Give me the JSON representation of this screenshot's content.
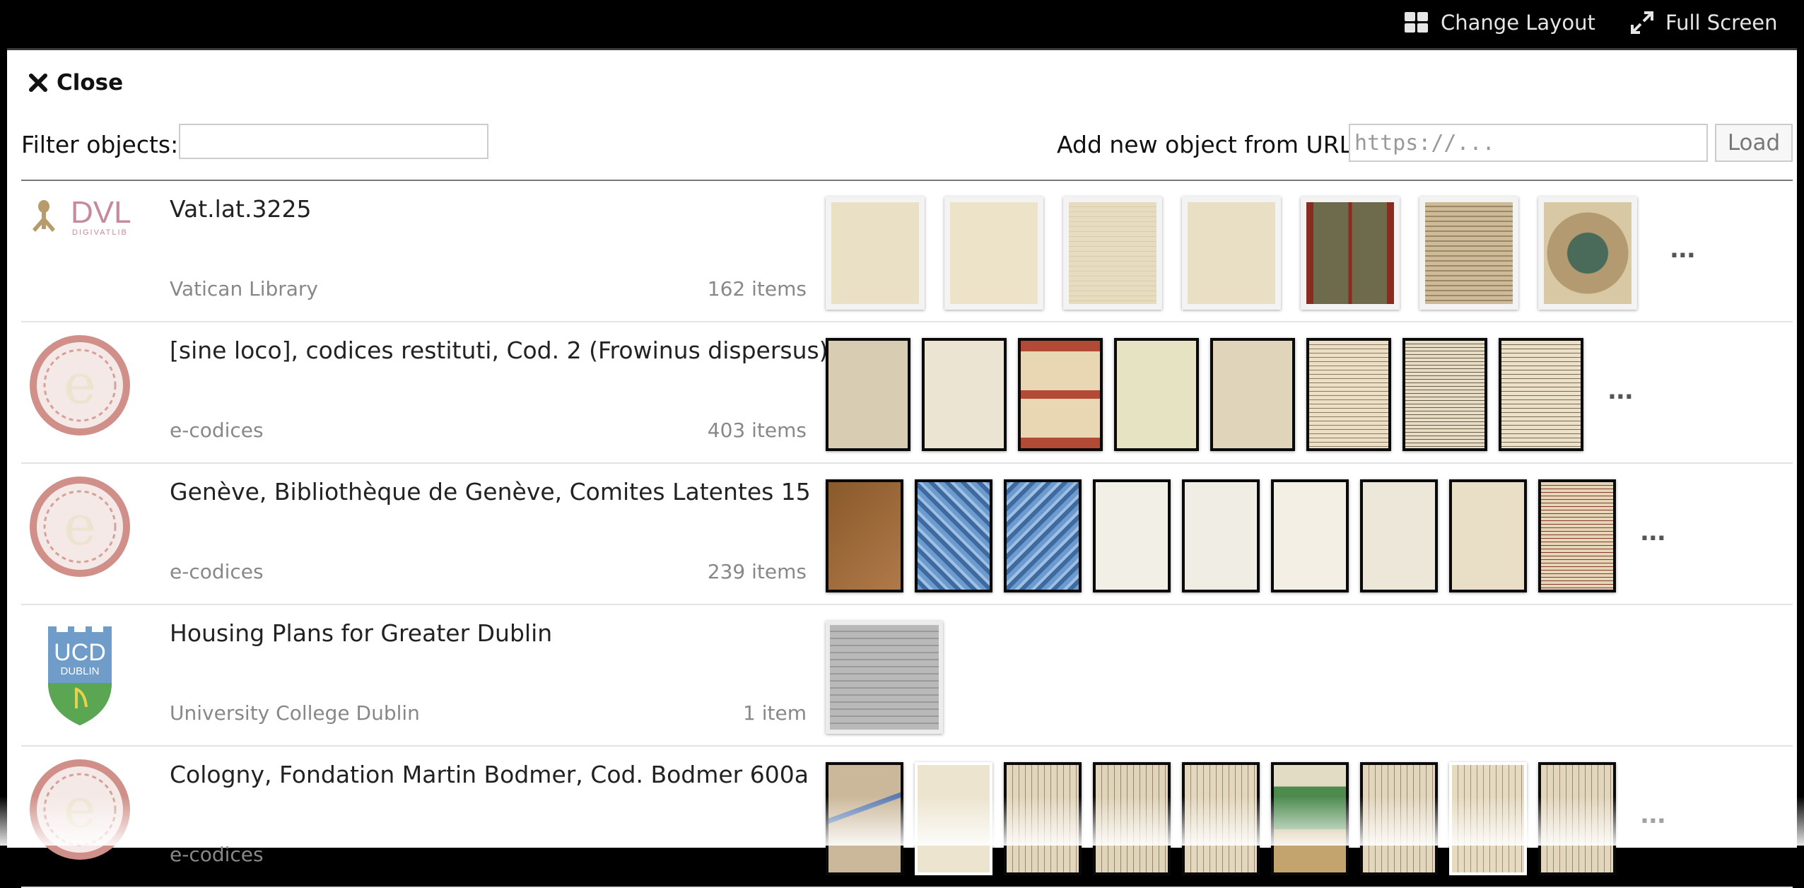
{
  "topbar": {
    "change_layout": "Change Layout",
    "full_screen": "Full Screen"
  },
  "panel": {
    "close_label": "Close",
    "filter_label": "Filter objects:",
    "filter_value": "",
    "url_label": "Add new object from URL:",
    "url_placeholder": "https://...",
    "load_label": "Load"
  },
  "objects": [
    {
      "title": "Vat.lat.3225",
      "provider": "Vatican Library",
      "count": "162 items",
      "logo": "dvl-logo",
      "thumb_style": "light",
      "thumb_count": 7
    },
    {
      "title": "[sine loco], codices restituti, Cod. 2 (Frowinus dispersus)",
      "provider": "e-codices",
      "count": "403 items",
      "logo": "e-codices-logo",
      "thumb_style": "dark",
      "thumb_count": 8
    },
    {
      "title": "Genève, Bibliothèque de Genève, Comites Latentes 15",
      "provider": "e-codices",
      "count": "239 items",
      "logo": "e-codices-logo",
      "thumb_style": "dark",
      "thumb_count": 9
    },
    {
      "title": "Housing Plans for Greater Dublin",
      "provider": "University College Dublin",
      "count": "1 item",
      "logo": "ucd-logo",
      "thumb_style": "light",
      "thumb_count": 1
    },
    {
      "title": "Cologny, Fondation Martin Bodmer, Cod. Bodmer 600a",
      "provider": "e-codices",
      "count": "",
      "logo": "e-codices-logo",
      "thumb_style": "dark",
      "thumb_count": 9
    }
  ],
  "logos": {
    "dvl_text": "DVL",
    "dvl_sub": "DIGIVATLIB",
    "ucd_text": "UCD",
    "ucd_sub": "DUBLIN"
  },
  "more_label": "...",
  "colors": {
    "background": "#000000",
    "panel": "#ffffff",
    "muted_text": "#888888",
    "ecodices_red": "#c97a72",
    "ucd_blue": "#6f9cc8",
    "ucd_green": "#5aa653"
  }
}
